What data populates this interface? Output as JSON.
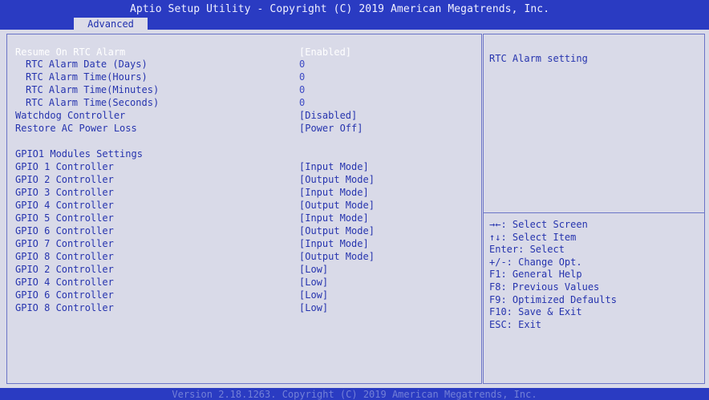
{
  "header": {
    "title": "Aptio Setup Utility - Copyright (C) 2019 American Megatrends, Inc.",
    "tab": "Advanced"
  },
  "settings": [
    {
      "label": "Resume On RTC Alarm",
      "value": "[Enabled]"
    },
    {
      "label": "RTC Alarm Date (Days)",
      "value": "0"
    },
    {
      "label": "RTC Alarm Time(Hours)",
      "value": "0"
    },
    {
      "label": "RTC Alarm Time(Minutes)",
      "value": "0"
    },
    {
      "label": "RTC Alarm Time(Seconds)",
      "value": "0"
    },
    {
      "label": "Watchdog Controller",
      "value": "[Disabled]"
    },
    {
      "label": "Restore AC Power Loss",
      "value": "[Power Off]"
    },
    {
      "label": "GPIO1 Modules Settings",
      "value": ""
    },
    {
      "label": "GPIO 1 Controller",
      "value": "[Input Mode]"
    },
    {
      "label": "GPIO 2 Controller",
      "value": "[Output Mode]"
    },
    {
      "label": "GPIO 3 Controller",
      "value": "[Input Mode]"
    },
    {
      "label": "GPIO 4 Controller",
      "value": "[Output Mode]"
    },
    {
      "label": "GPIO 5 Controller",
      "value": "[Input Mode]"
    },
    {
      "label": "GPIO 6 Controller",
      "value": "[Output Mode]"
    },
    {
      "label": "GPIO 7 Controller",
      "value": "[Input Mode]"
    },
    {
      "label": "GPIO 8 Controller",
      "value": "[Output Mode]"
    },
    {
      "label": "GPIO 2 Controller",
      "value": "[Low]"
    },
    {
      "label": "GPIO 4 Controller",
      "value": "[Low]"
    },
    {
      "label": "GPIO 6 Controller",
      "value": "[Low]"
    },
    {
      "label": "GPIO 8 Controller",
      "value": "[Low]"
    }
  ],
  "help": {
    "description": "RTC Alarm setting",
    "keys": [
      "→←: Select Screen",
      "↑↓: Select Item",
      "Enter: Select",
      "+/-: Change Opt.",
      "F1: General Help",
      "F8: Previous Values",
      "F9: Optimized Defaults",
      "F10: Save & Exit",
      "ESC: Exit"
    ]
  },
  "footer": "Version 2.18.1263. Copyright (C) 2019 American Megatrends, Inc.",
  "colors": {
    "bar_blue": "#2a3bc2",
    "background": "#d9dae8",
    "text_blue": "#2634ae",
    "selected_text": "#ffffff"
  }
}
